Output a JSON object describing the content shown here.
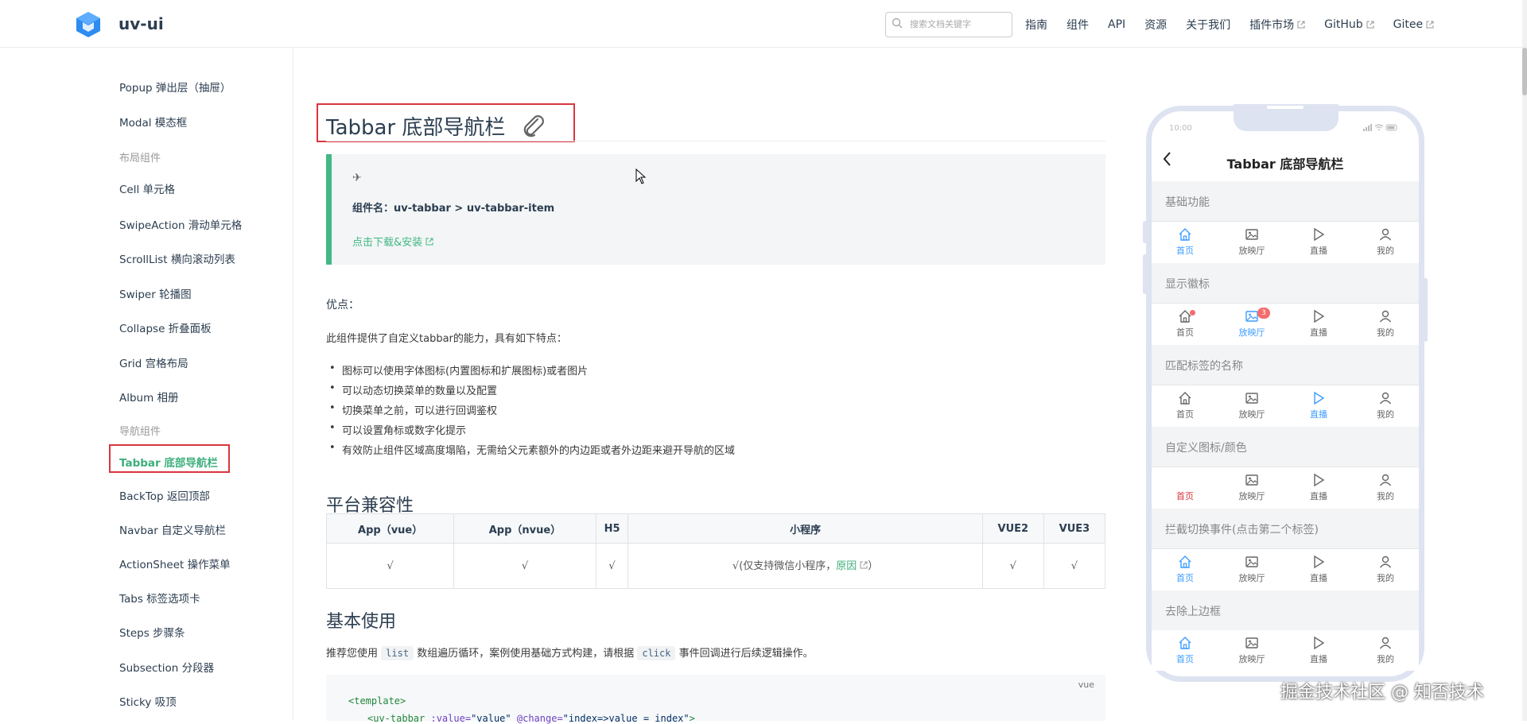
{
  "header": {
    "brand": "uv-ui",
    "search_placeholder": "搜索文档关键字",
    "nav": [
      {
        "label": "指南",
        "external": false
      },
      {
        "label": "组件",
        "external": false
      },
      {
        "label": "API",
        "external": false
      },
      {
        "label": "资源",
        "external": false
      },
      {
        "label": "关于我们",
        "external": false
      },
      {
        "label": "插件市场",
        "external": true
      },
      {
        "label": "GitHub",
        "external": true
      },
      {
        "label": "Gitee",
        "external": true
      }
    ]
  },
  "sidebar": {
    "items": [
      {
        "label": "Popup 弹出层（抽屉）"
      },
      {
        "label": "Modal 模态框"
      },
      {
        "group": "布局组件"
      },
      {
        "label": "Cell 单元格"
      },
      {
        "label": "SwipeAction 滑动单元格"
      },
      {
        "label": "ScrollList 横向滚动列表"
      },
      {
        "label": "Swiper 轮播图"
      },
      {
        "label": "Collapse 折叠面板"
      },
      {
        "label": "Grid 宫格布局"
      },
      {
        "label": "Album 相册"
      },
      {
        "group": "导航组件"
      },
      {
        "label": "Tabbar 底部导航栏",
        "active": true
      },
      {
        "label": "BackTop 返回顶部"
      },
      {
        "label": "Navbar 自定义导航栏"
      },
      {
        "label": "ActionSheet 操作菜单"
      },
      {
        "label": "Tabs 标签选项卡"
      },
      {
        "label": "Steps 步骤条"
      },
      {
        "label": "Subsection 分段器"
      },
      {
        "label": "Sticky 吸顶"
      }
    ]
  },
  "main": {
    "title": "Tabbar 底部导航栏",
    "tip": {
      "icon": "✈",
      "component_name": "组件名：uv-tabbar > uv-tabbar-item",
      "download_link": "点击下载&安装"
    },
    "advantages_title": "优点：",
    "intro": "此组件提供了自定义tabbar的能力，具有如下特点：",
    "features": [
      "图标可以使用字体图标(内置图标和扩展图标)或者图片",
      "可以动态切换菜单的数量以及配置",
      "切换菜单之前，可以进行回调鉴权",
      "可以设置角标或数字化提示",
      "有效防止组件区域高度塌陷，无需给父元素额外的内边距或者外边距来避开导航的区域"
    ],
    "compat_title": "平台兼容性",
    "compat_headers": [
      "App（vue）",
      "App（nvue）",
      "H5",
      "小程序",
      "VUE2",
      "VUE3"
    ],
    "compat_check": "√",
    "compat_miniapp_note": "√(仅支持微信小程序，",
    "compat_miniapp_link": "原因",
    "compat_miniapp_tail": "）",
    "basic_title": "基本使用",
    "basic_desc_1": "推荐您使用",
    "basic_code_1": "list",
    "basic_desc_2": "数组遍历循环，案例使用基础方式构建，请根据",
    "basic_code_2": "click",
    "basic_desc_3": "事件回调进行后续逻辑操作。",
    "code_lang": "vue",
    "code_line_1": "<template>",
    "code_line_2_tag": "<uv-tabbar",
    "code_line_2_attr1": ":value=",
    "code_line_2_str1": "\"value\"",
    "code_line_2_attr2": "@change=",
    "code_line_2_str2": "\"index=>value = index\"",
    "code_line_2_end": ">"
  },
  "phone": {
    "time": "10:00",
    "title": "Tabbar 底部导航栏",
    "tab_labels": [
      "首页",
      "放映厅",
      "直播",
      "我的"
    ],
    "badge_count": "3",
    "sections": [
      {
        "label": "基础功能",
        "active": 0
      },
      {
        "label": "显示徽标",
        "active": 1
      },
      {
        "label": "匹配标签的名称",
        "active": 2
      },
      {
        "label": "自定义图标/颜色",
        "active": 0
      },
      {
        "label": "拦截切换事件(点击第二个标签)",
        "active": 0
      },
      {
        "label": "去除上边框",
        "active": 0
      }
    ]
  },
  "watermark": "掘金技术社区 @ 知否技术",
  "colors": {
    "accent": "#3eaf7c",
    "tabbar_active": "#3c9cff",
    "highlight_box": "#d9363e",
    "badge": "#f56c6c"
  }
}
